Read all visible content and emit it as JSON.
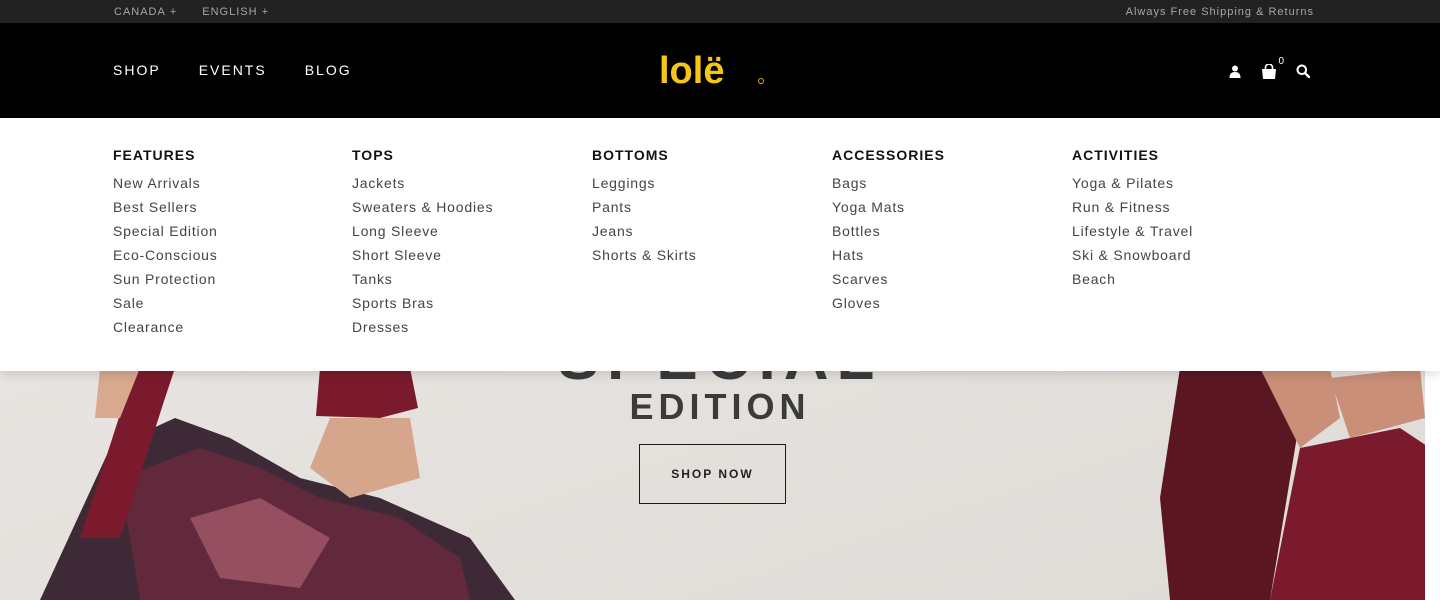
{
  "utility": {
    "country": "CANADA",
    "language": "ENGLISH",
    "plus": "+",
    "shipping": "Always Free Shipping & Returns"
  },
  "nav": {
    "items": [
      "SHOP",
      "EVENTS",
      "BLOG"
    ]
  },
  "brand": {
    "logo_text": "lolë",
    "color": "#f5c518"
  },
  "header": {
    "cart_count": "0"
  },
  "icons": [
    "user-icon",
    "shopping-bag-icon",
    "search-icon"
  ],
  "mega_menu": {
    "columns": [
      {
        "title": "FEATURES",
        "items": [
          "New Arrivals",
          "Best Sellers",
          "Special Edition",
          "Eco-Conscious",
          "Sun Protection",
          "Sale",
          "Clearance"
        ]
      },
      {
        "title": "TOPS",
        "items": [
          "Jackets",
          "Sweaters & Hoodies",
          "Long Sleeve",
          "Short Sleeve",
          "Tanks",
          "Sports Bras",
          "Dresses"
        ]
      },
      {
        "title": "BOTTOMS",
        "items": [
          "Leggings",
          "Pants",
          "Jeans",
          "Shorts & Skirts"
        ]
      },
      {
        "title": "ACCESSORIES",
        "items": [
          "Bags",
          "Yoga Mats",
          "Bottles",
          "Hats",
          "Scarves",
          "Gloves"
        ]
      },
      {
        "title": "ACTIVITIES",
        "items": [
          "Yoga & Pilates",
          "Run & Fitness",
          "Lifestyle & Travel",
          "Ski & Snowboard",
          "Beach"
        ]
      }
    ]
  },
  "hero": {
    "title_line1": "SPECIAL",
    "title_line2": "EDITION",
    "cta": "SHOP NOW"
  },
  "colors": {
    "black": "#000000",
    "utility_bg": "#222222",
    "accent": "#f5c518",
    "hero_bg": "#e7e4e1",
    "garment": "#7a1a2c"
  }
}
